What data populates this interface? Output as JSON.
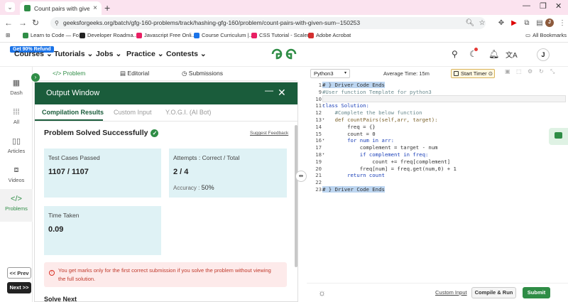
{
  "browser": {
    "tab_title": "Count pairs with given sum | Pr",
    "new_tab": "+",
    "url": "geeksforgeeks.org/batch/gfg-160-problems/track/hashing-gfg-160/problem/count-pairs-with-given-sum--150253",
    "avatar_letter": "J",
    "bookmarks": [
      {
        "label": "Learn to Code — Fo...",
        "color": "#2f8d46"
      },
      {
        "label": "Developer Roadma...",
        "color": "#222222"
      },
      {
        "label": "Javascript Free Onli...",
        "color": "#e91e63"
      },
      {
        "label": "Course Curriculum |...",
        "color": "#1a73e8"
      },
      {
        "label": "CSS Tutorial - Scaler...",
        "color": "#e91e63"
      },
      {
        "label": "Adobe Acrobat",
        "color": "#d32f2f"
      }
    ],
    "all_bookmarks": "All Bookmarks"
  },
  "site": {
    "promo": "Get 90% Refund",
    "menu": [
      "Courses",
      "Tutorials",
      "Jobs",
      "Practice",
      "Contests"
    ],
    "user_initial": "J"
  },
  "sidebar": {
    "items": [
      {
        "label": "Dash",
        "icon": "dashboard-icon"
      },
      {
        "label": "All",
        "icon": "grid-icon"
      },
      {
        "label": "Articles",
        "icon": "book-icon"
      },
      {
        "label": "Videos",
        "icon": "video-icon"
      },
      {
        "label": "Problems",
        "icon": "code-icon"
      }
    ],
    "prev": "<< Prev",
    "next": "Next >>"
  },
  "problem_tabs": [
    "Problem",
    "Editorial",
    "Submissions"
  ],
  "output": {
    "title": "Output Window",
    "tabs": [
      "Compilation Results",
      "Custom Input",
      "Y.O.G.I. (AI Bot)"
    ],
    "status": "Problem Solved Successfully",
    "feedback": "Suggest Feedback",
    "test_cases_label": "Test Cases Passed",
    "test_cases_value": "1107 / 1107",
    "attempts_label": "Attempts : Correct / Total",
    "attempts_value": "2 / 4",
    "accuracy_label": "Accuracy :",
    "accuracy_value": "50%",
    "time_label": "Time Taken",
    "time_value": "0.09",
    "warning": "You get marks only for the first correct submission if you solve the problem without viewing the full solution.",
    "solve_next": "Solve Next"
  },
  "editor": {
    "language": "Python3",
    "avg_time": "Average Time: 15m",
    "timer": "Start Timer",
    "lines": [
      {
        "n": "1",
        "fold": true,
        "text": "# } Driver Code Ends",
        "style": "hl"
      },
      {
        "n": "9",
        "fold": false,
        "text": "#User function Template for python3",
        "style": "cm"
      },
      {
        "n": "10",
        "fold": false,
        "text": "",
        "style": "cur"
      },
      {
        "n": "11",
        "fold": true,
        "text": "class Solution:",
        "style": "kw"
      },
      {
        "n": "12",
        "fold": false,
        "text": "    #Complete the below function",
        "style": "cm"
      },
      {
        "n": "13",
        "fold": true,
        "text": "    def countPairs(self,arr, target):",
        "style": "def"
      },
      {
        "n": "14",
        "fold": false,
        "text": "        freq = {}",
        "style": ""
      },
      {
        "n": "15",
        "fold": false,
        "text": "        count = 0",
        "style": ""
      },
      {
        "n": "16",
        "fold": true,
        "text": "        for num in arr:",
        "style": "kw"
      },
      {
        "n": "17",
        "fold": false,
        "text": "            complement = target - num",
        "style": ""
      },
      {
        "n": "18",
        "fold": true,
        "text": "            if complement in freq:",
        "style": "kw"
      },
      {
        "n": "19",
        "fold": false,
        "text": "                count += freq[complement]",
        "style": ""
      },
      {
        "n": "20",
        "fold": false,
        "text": "            freq[num] = freq.get(num,0) + 1",
        "style": ""
      },
      {
        "n": "21",
        "fold": false,
        "text": "        return count",
        "style": "kw"
      },
      {
        "n": "22",
        "fold": false,
        "text": "",
        "style": ""
      },
      {
        "n": "23",
        "fold": true,
        "text": "# } Driver Code Ends",
        "style": "hl"
      }
    ],
    "custom_input": "Custom Input",
    "compile_run": "Compile & Run",
    "submit": "Submit"
  }
}
